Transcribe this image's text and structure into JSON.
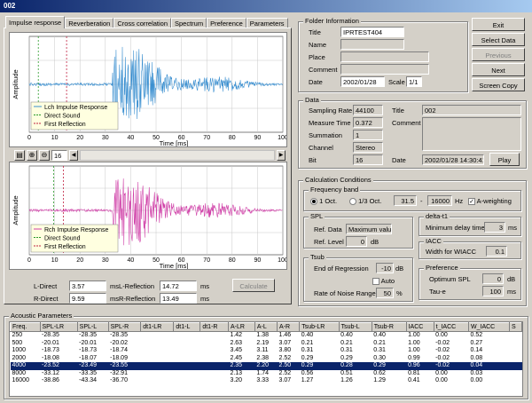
{
  "window": {
    "title": "002"
  },
  "tabs": [
    "Impulse response",
    "Reverberation",
    "Cross correlation",
    "Spectrum",
    "Preference",
    "Parameters"
  ],
  "plot_top": {
    "ylabel": "Amplitude",
    "xlabel": "Time [ms]",
    "xticks": [
      "0",
      "10",
      "20",
      "30",
      "40",
      "50",
      "60",
      "70",
      "80",
      "90",
      "100"
    ],
    "legend": [
      "Lch Impulse Response",
      "Direct Sound",
      "First Reflection"
    ],
    "colors": {
      "signal": "#3a8fd0",
      "direct": "#2a9a2a",
      "reflection": "#c02040"
    }
  },
  "plot_bottom": {
    "ylabel": "Amplitude",
    "xlabel": "Time [ms]",
    "xticks": [
      "0",
      "10",
      "20",
      "30",
      "40",
      "50",
      "60",
      "70",
      "80",
      "90",
      "100"
    ],
    "legend": [
      "Rch Impulse Response",
      "Direct Sound",
      "First Reflection"
    ],
    "colors": {
      "signal": "#d040a8",
      "direct": "#2a9a2a",
      "reflection": "#c02040"
    }
  },
  "toolbar": {
    "zoom_value": "16"
  },
  "readouts": {
    "l_direct_label": "L-Direct",
    "l_direct": "3.57",
    "l_direct_unit": "ms",
    "r_direct_label": "R-Direct",
    "r_direct": "9.59",
    "r_direct_unit": "ms",
    "l_refl_label": "L-Reflection",
    "l_refl": "14.72",
    "l_refl_unit": "ms",
    "r_refl_label": "R-Reflection",
    "r_refl": "13.49",
    "r_refl_unit": "ms",
    "calculate": "Calculate"
  },
  "folder": {
    "group": "Folder Information",
    "title_label": "Title",
    "title": "IPRTEST404",
    "name_label": "Name",
    "name": "",
    "place_label": "Place",
    "place": "",
    "comment_label": "Comment",
    "comment": "",
    "date_label": "Date",
    "date": "2002/01/28",
    "scale_label": "Scale",
    "scale": "1/1"
  },
  "buttons": {
    "exit": "Exit",
    "select_data": "Select Data",
    "previous": "Previous",
    "next": "Next",
    "screen_copy": "Screen Copy"
  },
  "data": {
    "group": "Data",
    "sampling_label": "Sampling Rate",
    "sampling": "44100",
    "measure_label": "Measure Time",
    "measure": "0.372",
    "summation_label": "Summation",
    "summation": "1",
    "channel_label": "Channel",
    "channel": "Stereo",
    "bit_label": "Bit",
    "bit": "16",
    "title_label": "Title",
    "title": "002",
    "comment_label": "Comment",
    "comment": "",
    "date_label": "Date",
    "date": "2002/01/28 14:30:41",
    "play": "Play"
  },
  "calc": {
    "group": "Calculation Conditions",
    "freq_group": "Frequency band",
    "oct1": "1 Oct.",
    "oct3": "1/3 Oct.",
    "f_low": "31.5",
    "f_high": "16000",
    "f_unit": "Hz",
    "aweight": "A-weighting",
    "spl_group": "SPL",
    "ref_data_label": "Ref. Data",
    "ref_data": "Maximum value",
    "ref_level_label": "Ref. Level",
    "ref_level": "0",
    "ref_level_unit": "dB",
    "delta_group": "delta-t1",
    "min_delay_label": "Minimum delay time",
    "min_delay": "3",
    "min_delay_unit": "ms",
    "iacc_group": "IACC",
    "wiacc_label": "Width for WIACC",
    "wiacc": "0.1",
    "tsub_group": "Tsub",
    "end_reg_label": "End of Regression",
    "end_reg": "-10",
    "end_reg_unit": "dB",
    "auto": "Auto",
    "noise_label": "Rate of Noise Range",
    "noise": "50",
    "noise_unit": "%",
    "pref_group": "Preference",
    "opt_spl_label": "Optimum SPL",
    "opt_spl": "0",
    "opt_spl_unit": "dB",
    "taue_label": "Tau-e",
    "taue": "100",
    "taue_unit": "ms"
  },
  "acoustic": {
    "group": "Acoustic Parameters",
    "headers": [
      "Freq.",
      "SPL-LR",
      "SPL-L",
      "SPL-R",
      "dt1-LR",
      "dt1-L",
      "dt1-R",
      "A-LR",
      "A-L",
      "A-R",
      "Tsub-LR",
      "Tsub-L",
      "Tsub-R",
      "IACC",
      "t_IACC",
      "W_IACC",
      "S"
    ],
    "rows": [
      [
        "250",
        "-28.35",
        "-28.35",
        "-28.35",
        "",
        "",
        "",
        "1.42",
        "1.38",
        "1.46",
        "0.40",
        "0.40",
        "0.40",
        "1.00",
        "0.00",
        "0.52",
        ""
      ],
      [
        "500",
        "-20.01",
        "-20.01",
        "-20.02",
        "",
        "",
        "",
        "2.63",
        "2.19",
        "3.07",
        "0.21",
        "0.21",
        "0.21",
        "1.00",
        "-0.02",
        "0.27",
        ""
      ],
      [
        "1000",
        "-18.73",
        "-18.73",
        "-18.74",
        "",
        "",
        "",
        "3.45",
        "3.11",
        "3.80",
        "0.31",
        "0.31",
        "0.31",
        "1.00",
        "-0.02",
        "0.14",
        ""
      ],
      [
        "2000",
        "-18.08",
        "-18.07",
        "-18.09",
        "",
        "",
        "",
        "2.45",
        "2.38",
        "2.52",
        "0.29",
        "0.29",
        "0.30",
        "0.99",
        "-0.02",
        "0.08",
        ""
      ],
      [
        "4000",
        "-23.52",
        "-23.49",
        "-23.55",
        "",
        "",
        "",
        "2.35",
        "2.20",
        "2.50",
        "0.29",
        "0.28",
        "0.29",
        "0.96",
        "-0.02",
        "0.04",
        ""
      ],
      [
        "8000",
        "-33.12",
        "-33.35",
        "-32.91",
        "",
        "",
        "",
        "2.13",
        "1.74",
        "2.52",
        "0.56",
        "0.51",
        "0.62",
        "0.81",
        "0.00",
        "0.03",
        ""
      ],
      [
        "16000",
        "-38.86",
        "-43.34",
        "-36.70",
        "",
        "",
        "",
        "3.20",
        "3.33",
        "3.07",
        "1.27",
        "1.26",
        "1.29",
        "0.41",
        "0.00",
        "0.00",
        ""
      ]
    ],
    "selected_row": 4
  }
}
